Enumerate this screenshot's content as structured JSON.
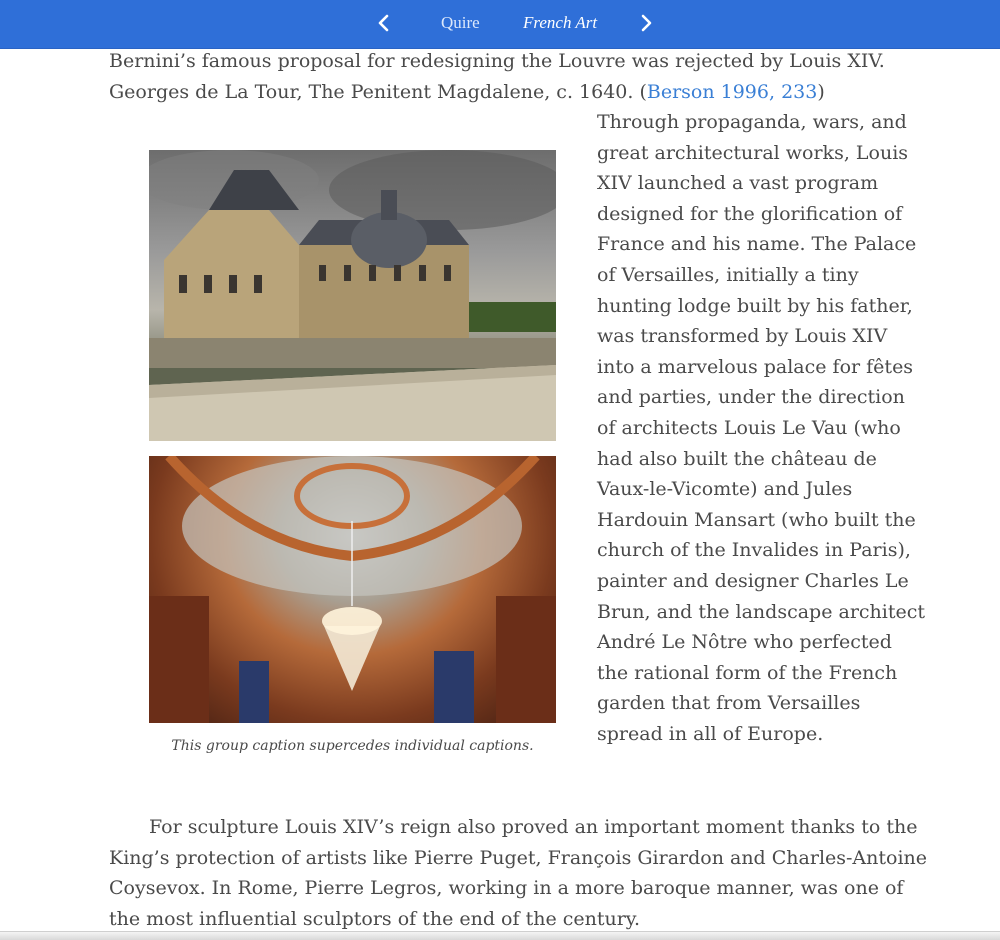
{
  "nav": {
    "prev_icon": "chevron-left-icon",
    "next_icon": "chevron-right-icon",
    "title": "Quire",
    "section": "French Art",
    "bar_color": "#2f6fd8"
  },
  "intro": {
    "text": "Bernini’s famous proposal for redesigning the Louvre was rejected by Louis XIV. Georges de La Tour, The Penitent Magdalene, c. 1640. (",
    "citation": "Berson 1996, 233",
    "close": ")"
  },
  "figure": {
    "caption": "This group caption supercedes individual captions."
  },
  "body": {
    "right_paragraph": "Through propaganda, wars, and great architectural works, Louis XIV launched a vast program designed for the glorification of France and his name. The Palace of Versailles, initially a tiny hunting lodge built by his father, was transformed by Louis XIV into a marvelous palace for fêtes and parties, under the direction of architects Louis Le Vau (who had also built the château de Vaux-le-Vicomte) and Jules Hardouin Mansart (who built the church of the Invalides in Paris), painter and designer Charles Le Brun, and the landscape architect André Le Nôtre who perfected the rational form of the French garden that from Versailles spread in all of Europe.",
    "bottom_paragraph": "For sculpture Louis XIV’s reign also proved an important moment thanks to the King’s protection of artists like Pierre Puget, François Girardon and Charles-Antoine Coysevox. In Rome, Pierre Legros, working in a more baroque manner, was one of the most influential sculptors of the end of the century."
  },
  "colors": {
    "link": "#3a7fd5",
    "text": "#4a4a4a"
  }
}
